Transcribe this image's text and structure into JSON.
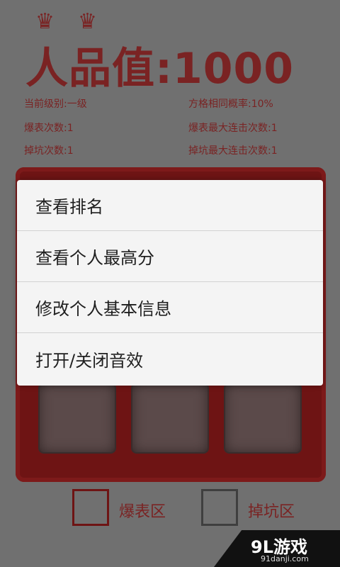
{
  "game": {
    "title": "人品值:1000",
    "crown_glyph": "♛",
    "stats_left": [
      "当前级别:一级",
      "爆表次数:1",
      "掉坑次数:1"
    ],
    "stats_right": [
      "方格相同概率:10%",
      "爆表最大连击次数:1",
      "掉坑最大连击次数:1"
    ],
    "legend": {
      "burst_label": "爆表区",
      "pit_label": "掉坑区"
    }
  },
  "menu": {
    "items": [
      "查看排名",
      "查看个人最高分",
      "修改个人基本信息",
      "打开/关闭音效"
    ]
  },
  "watermark": {
    "logo": "9L游戏",
    "site": "91danji.com"
  },
  "colors": {
    "accent": "#7a2323",
    "menu_bg": "#f4f4f4"
  }
}
